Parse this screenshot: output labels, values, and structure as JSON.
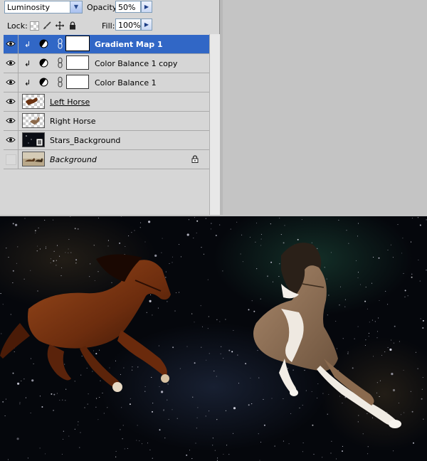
{
  "options_bar": {
    "blend_mode": "Luminosity",
    "opacity_label": "Opacity:",
    "opacity_value": "50%",
    "lock_label": "Lock:",
    "fill_label": "Fill:",
    "fill_value": "100%"
  },
  "layers": [
    {
      "name": "Gradient Map 1",
      "type": "adjustment",
      "clipped": true,
      "selected": true,
      "visible": true
    },
    {
      "name": "Color Balance 1 copy",
      "type": "adjustment",
      "clipped": true,
      "selected": false,
      "visible": true
    },
    {
      "name": "Color Balance 1",
      "type": "adjustment",
      "clipped": true,
      "selected": false,
      "visible": true
    },
    {
      "name": "Left Horse",
      "type": "pixel",
      "selected": false,
      "visible": true
    },
    {
      "name": "Right Horse",
      "type": "pixel",
      "selected": false,
      "visible": true
    },
    {
      "name": "Stars_Background",
      "type": "smart-object",
      "selected": false,
      "visible": true
    },
    {
      "name": "Background",
      "type": "background",
      "locked": true,
      "selected": false,
      "visible": false
    }
  ],
  "colors": {
    "panel_bg": "#d6d6d6",
    "selected_row": "#3167c6",
    "space_bg": "#05070c",
    "left_horse": "#7a3512",
    "right_horse": "#8f7256"
  },
  "icons": [
    "chevron-down-icon",
    "arrow-right-icon",
    "eye-icon",
    "lock-transparent-icon",
    "brush-icon",
    "move-icon",
    "padlock-icon",
    "adjustment-layer-icon",
    "chain-link-icon",
    "clipping-arrow-icon"
  ]
}
